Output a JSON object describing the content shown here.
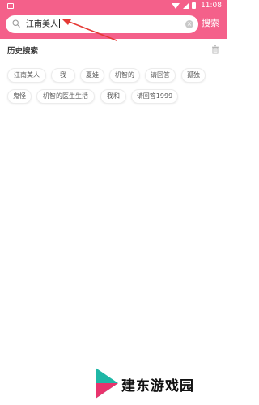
{
  "status_bar": {
    "time": "11:08"
  },
  "search": {
    "query": "江南美人",
    "button_label": "搜索",
    "clear_symbol": "×"
  },
  "history": {
    "title": "历史搜索",
    "items": [
      "江南美人",
      "我",
      "夏娃",
      "机智的",
      "请回答",
      "孤独",
      "鬼怪",
      "机智的医生生活",
      "我和",
      "请回答1999"
    ]
  },
  "watermark": {
    "text": "建东游戏园"
  },
  "colors": {
    "accent": "#f4608a",
    "arrow": "#e53935"
  },
  "icons": [
    "search-icon",
    "clear-icon",
    "trash-icon",
    "wifi-icon",
    "signal-icon",
    "battery-icon"
  ]
}
